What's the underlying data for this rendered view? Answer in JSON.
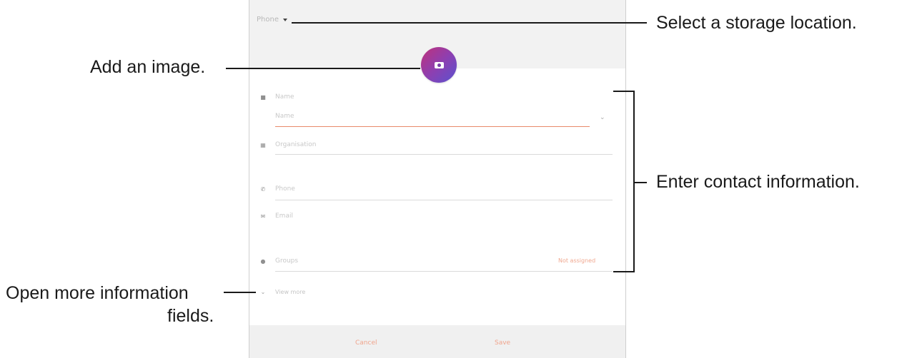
{
  "callouts": {
    "storage": "Select a storage location.",
    "image": "Add an image.",
    "contact": "Enter contact information.",
    "more_line1": "Open more information",
    "more_line2": "fields."
  },
  "screen": {
    "storage_label": "Phone",
    "fields": {
      "name": "Name",
      "name_sub": "Name",
      "organization": "Organisation",
      "phone": "Phone",
      "email": "Email",
      "groups": "Groups",
      "groups_action": "Not assigned"
    },
    "view_more": "View more",
    "cancel": "Cancel",
    "save": "Save"
  },
  "colors": {
    "accent": "#e88a6a",
    "avatar_gradient_start": "#c0317a",
    "avatar_gradient_end": "#5a52cf"
  }
}
